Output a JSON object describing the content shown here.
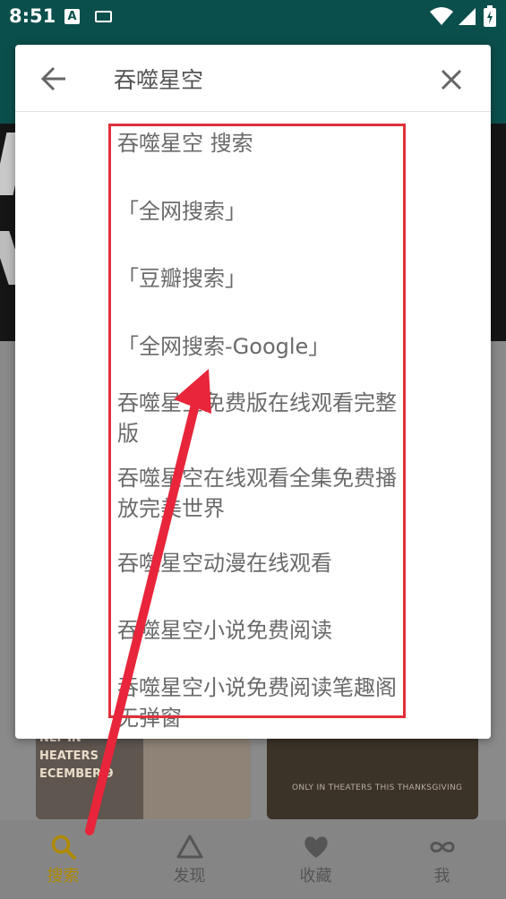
{
  "status_bar": {
    "time": "8:51",
    "a_icon_letter": "A",
    "icons": [
      "a-notification-icon",
      "keyboard-icon",
      "wifi-icon",
      "signal-icon",
      "battery-icon"
    ]
  },
  "background_posters": {
    "poster1_lines": [
      "NLY IN",
      "HEATERS",
      "ECEMBER 9"
    ],
    "poster2_text": "ONLY IN THEATERS THIS THANKSGIVING"
  },
  "search": {
    "query": "吞噬星空",
    "back_icon": "arrow-left-icon",
    "clear_icon": "close-icon"
  },
  "suggestions": [
    "吞噬星空 搜索",
    "「全网搜索」",
    "「豆瓣搜索」",
    "「全网搜索-Google」",
    "吞噬星空免费版在线观看完整版",
    "吞噬星空在线观看全集免费播放完美世界",
    "吞噬星空动漫在线观看",
    "吞噬星空小说免费阅读",
    "吞噬星空小说免费阅读笔趣阁无弹窗"
  ],
  "bottom_nav": [
    {
      "label": "搜索",
      "icon": "search-icon",
      "active": true
    },
    {
      "label": "发现",
      "icon": "triangle-icon",
      "active": false
    },
    {
      "label": "收藏",
      "icon": "heart-icon",
      "active": false
    },
    {
      "label": "我",
      "icon": "infinity-icon",
      "active": false
    }
  ],
  "colors": {
    "teal": "#0b4f4c",
    "accent": "#b08a00",
    "annotation_red": "#e0303b"
  }
}
